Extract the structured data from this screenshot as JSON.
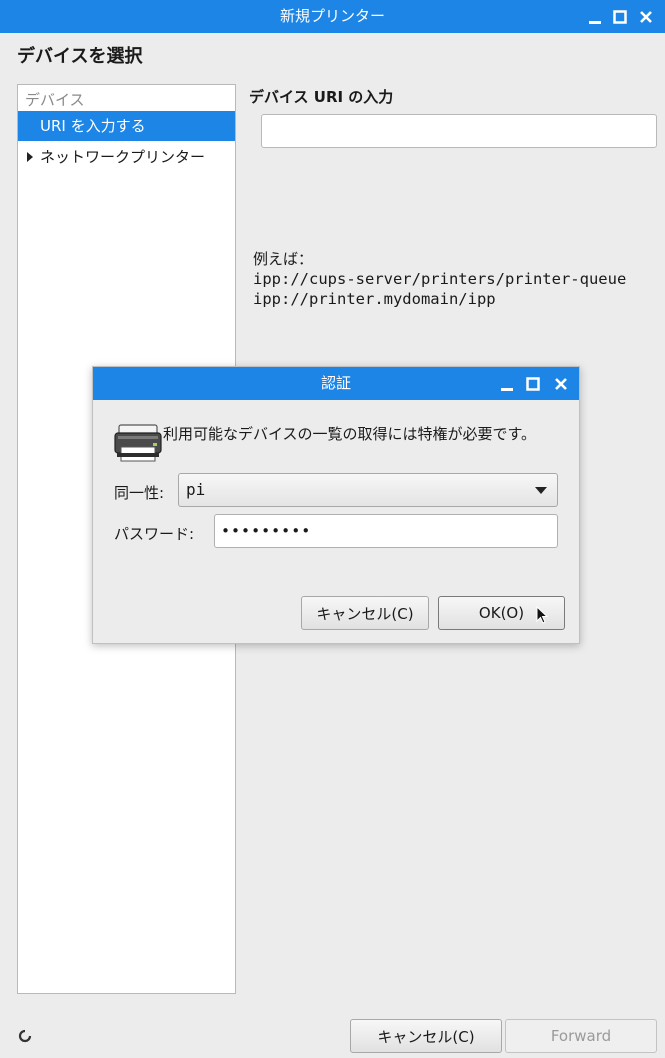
{
  "window": {
    "title": "新規プリンター",
    "heading": "デバイスを選択"
  },
  "sidebar": {
    "header": "デバイス",
    "items": [
      {
        "label": "URI を入力する",
        "selected": true
      },
      {
        "label": "ネットワークプリンター",
        "expandable": true
      }
    ]
  },
  "main": {
    "uri_label": "デバイス URI の入力",
    "uri_value": "",
    "example_heading": "例えば：",
    "example_lines": [
      "ipp://cups-server/printers/printer-queue",
      "ipp://printer.mydomain/ipp"
    ]
  },
  "footer": {
    "cancel_label": "キャンセル(C)",
    "forward_label": "Forward"
  },
  "auth_dialog": {
    "title": "認証",
    "message": "利用可能なデバイスの一覧の取得には特権が必要です。",
    "identity_label": "同一性:",
    "identity_value": "pi",
    "password_label": "パスワード:",
    "password_value": "•••••••••",
    "cancel_label": "キャンセル(C)",
    "ok_label": "OK(O)"
  },
  "colors": {
    "accent": "#1d85e6",
    "background": "#ececec"
  }
}
